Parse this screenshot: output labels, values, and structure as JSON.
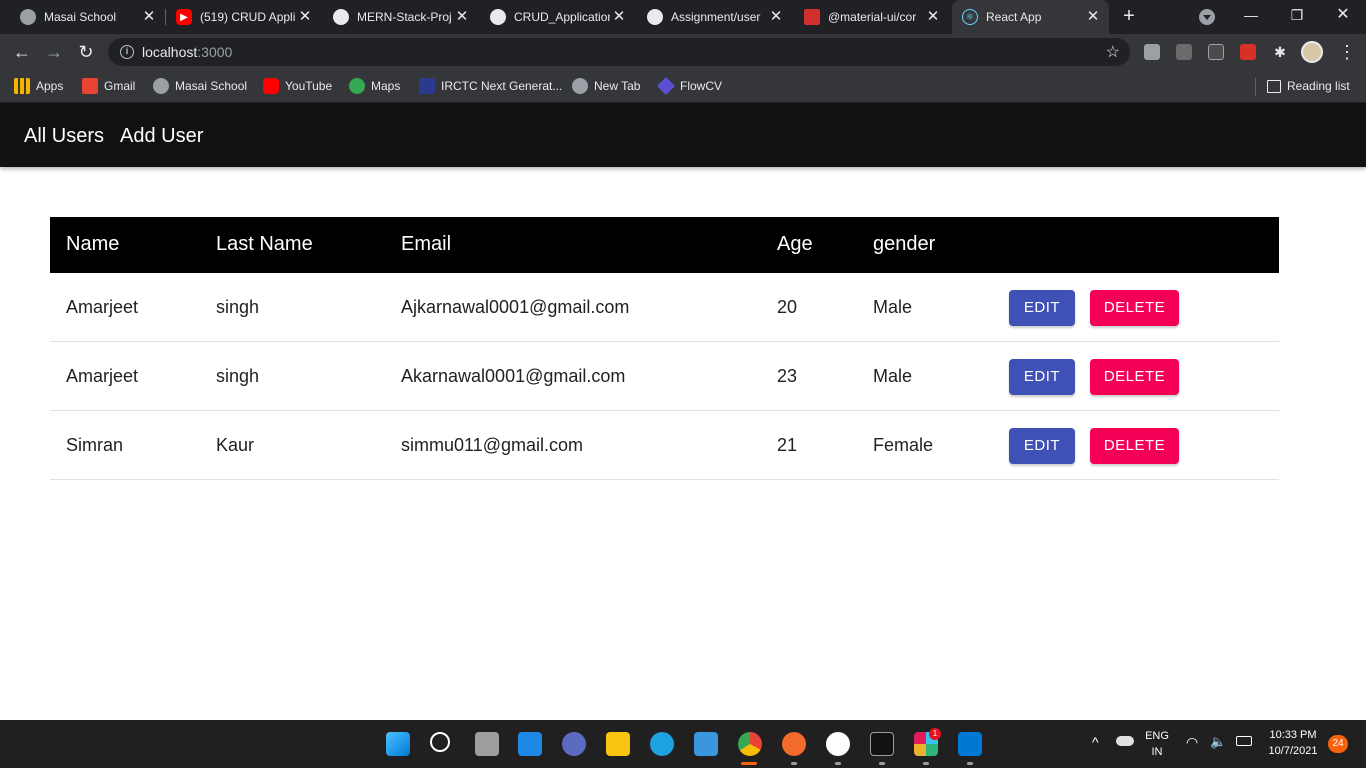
{
  "browser": {
    "tabs": [
      {
        "title": "Masai School",
        "icon": "globe-icon",
        "color": "#9aa0a6"
      },
      {
        "title": "(519) CRUD Appli",
        "icon": "youtube-icon",
        "color": "#ff0000"
      },
      {
        "title": "MERN-Stack-Proj",
        "icon": "github-icon",
        "color": "#e8eaed"
      },
      {
        "title": "CRUD_Application",
        "icon": "github-icon",
        "color": "#e8eaed"
      },
      {
        "title": "Assignment/user",
        "icon": "github-icon",
        "color": "#e8eaed"
      },
      {
        "title": "@material-ui/cor",
        "icon": "material-ui-icon",
        "color": "#d32f2f"
      },
      {
        "title": "React App",
        "icon": "react-icon",
        "color": "#61dafb"
      }
    ],
    "url_host": "localhost",
    "url_port": ":3000",
    "bookmarks": [
      {
        "label": "Apps",
        "icon": "apps-grid-icon",
        "color": "#f4b400"
      },
      {
        "label": "Gmail",
        "icon": "gmail-icon",
        "color": "#ea4335"
      },
      {
        "label": "Masai School",
        "icon": "globe-icon",
        "color": "#9aa0a6"
      },
      {
        "label": "YouTube",
        "icon": "youtube-icon",
        "color": "#ff0000"
      },
      {
        "label": "Maps",
        "icon": "maps-icon",
        "color": "#34a853"
      },
      {
        "label": "IRCTC Next Generat...",
        "icon": "irctc-icon",
        "color": "#2b3a8f"
      },
      {
        "label": "New Tab",
        "icon": "globe-icon",
        "color": "#9aa0a6"
      },
      {
        "label": "FlowCV",
        "icon": "flowcv-icon",
        "color": "#5b4fd6"
      }
    ],
    "reading_list": "Reading list"
  },
  "app": {
    "nav": {
      "all_users": "All Users",
      "add_user": "Add User"
    },
    "table": {
      "headers": [
        "Name",
        "Last Name",
        "Email",
        "Age",
        "gender"
      ],
      "rows": [
        {
          "name": "Amarjeet",
          "last_name": "singh",
          "email": "Ajkarnawal0001@gmail.com",
          "age": "20",
          "gender": "Male"
        },
        {
          "name": "Amarjeet",
          "last_name": "singh",
          "email": "Akarnawal0001@gmail.com",
          "age": "23",
          "gender": "Male"
        },
        {
          "name": "Simran",
          "last_name": "Kaur",
          "email": "simmu011@gmail.com",
          "age": "21",
          "gender": "Female"
        }
      ],
      "edit_label": "EDIT",
      "delete_label": "DELETE"
    },
    "colors": {
      "edit": "#3f51b5",
      "delete": "#f50057",
      "header": "#000000",
      "appbar": "#111111"
    }
  },
  "taskbar": {
    "lang_top": "ENG",
    "lang_bottom": "IN",
    "time": "10:33 PM",
    "date": "10/7/2021",
    "notifications": "24",
    "chrome_badge": "",
    "slack_badge": "1"
  }
}
